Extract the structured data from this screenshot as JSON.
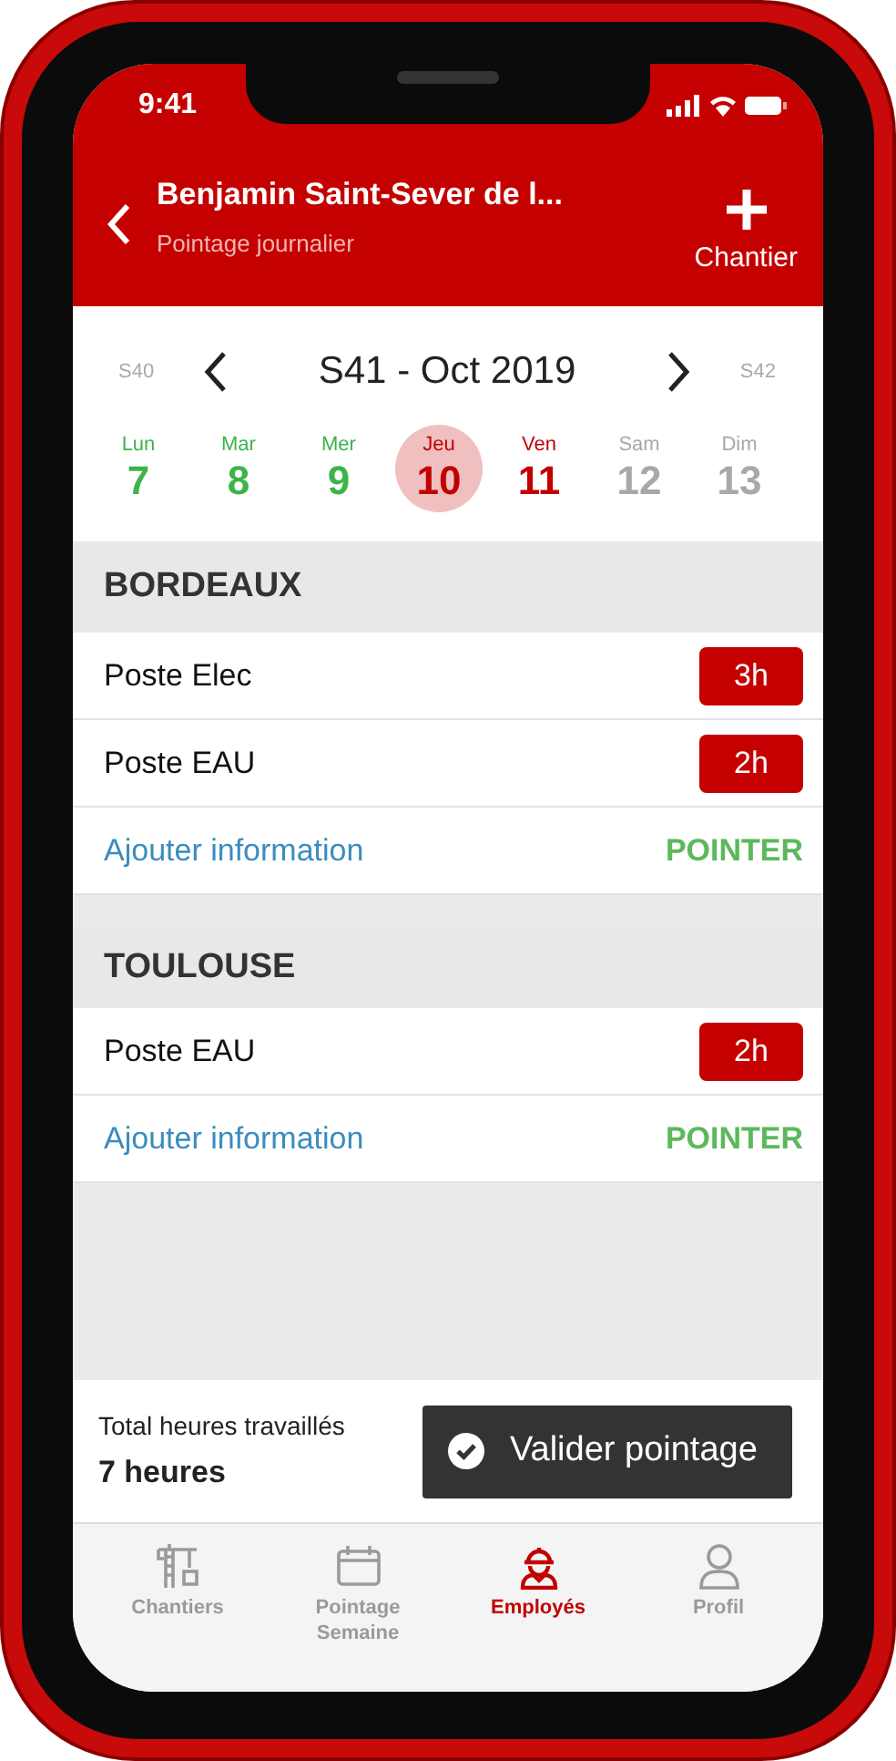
{
  "status_bar": {
    "time": "9:41"
  },
  "header": {
    "title": "Benjamin Saint-Sever de l...",
    "subtitle": "Pointage journalier",
    "action": "Chantier"
  },
  "week_nav": {
    "previous": "S40",
    "current": "S41 - Oct 2019",
    "next": "S42"
  },
  "days": [
    {
      "label": "Lun",
      "number": "7",
      "kind": "done",
      "selected": false
    },
    {
      "label": "Mar",
      "number": "8",
      "kind": "done",
      "selected": false
    },
    {
      "label": "Mer",
      "number": "9",
      "kind": "done",
      "selected": false
    },
    {
      "label": "Jeu",
      "number": "10",
      "kind": "pending",
      "selected": true
    },
    {
      "label": "Ven",
      "number": "11",
      "kind": "pending",
      "selected": false
    },
    {
      "label": "Sam",
      "number": "12",
      "kind": "weekend",
      "selected": false
    },
    {
      "label": "Dim",
      "number": "13",
      "kind": "weekend",
      "selected": false
    }
  ],
  "sites": [
    {
      "name": "BORDEAUX",
      "tasks": [
        {
          "name": "Poste Elec",
          "hours": "3h"
        },
        {
          "name": "Poste EAU",
          "hours": "2h"
        }
      ],
      "link": "Ajouter information",
      "action": "POINTER"
    },
    {
      "name": "TOULOUSE",
      "tasks": [
        {
          "name": "Poste EAU",
          "hours": "2h"
        }
      ],
      "link": "Ajouter information",
      "action": "POINTER"
    }
  ],
  "footer": {
    "total_label": "Total heures travaillés",
    "total_value": "7 heures",
    "button": "Valider pointage"
  },
  "tabs": [
    {
      "label": "Chantiers",
      "selected": false
    },
    {
      "label": "Pointage Semaine",
      "selected": false
    },
    {
      "label": "Employés",
      "selected": true
    },
    {
      "label": "Profil",
      "selected": false
    }
  ]
}
